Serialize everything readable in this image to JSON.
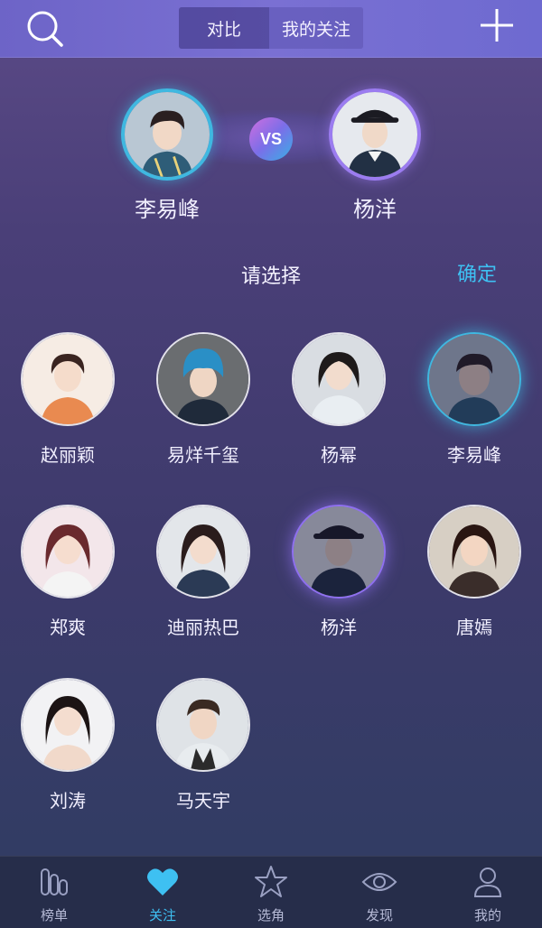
{
  "header": {
    "search_icon": "search-icon",
    "add_icon": "plus-icon",
    "segments": [
      {
        "label": "对比",
        "active": true
      },
      {
        "label": "我的关注",
        "active": false
      }
    ]
  },
  "versus": {
    "left": {
      "name": "李易峰",
      "ring_color": "#3fb8e0"
    },
    "badge": "VS",
    "right": {
      "name": "杨洋",
      "ring_color": "#9b7cf0"
    }
  },
  "chooser": {
    "title": "请选择",
    "confirm": "确定",
    "confirm_color": "#3ec0f2"
  },
  "celebrities": [
    {
      "name": "赵丽颖"
    },
    {
      "name": "易烊千玺"
    },
    {
      "name": "杨幂"
    },
    {
      "name": "李易峰",
      "selected": "left"
    },
    {
      "name": "郑爽"
    },
    {
      "name": "迪丽热巴"
    },
    {
      "name": "杨洋",
      "selected": "right"
    },
    {
      "name": "唐嫣"
    },
    {
      "name": "刘涛"
    },
    {
      "name": "马天宇"
    }
  ],
  "tabbar": {
    "items": [
      {
        "label": "榜单",
        "icon": "chart-bars-icon"
      },
      {
        "label": "关注",
        "icon": "heart-icon",
        "active": true
      },
      {
        "label": "选角",
        "icon": "star-icon"
      },
      {
        "label": "发现",
        "icon": "eye-icon"
      },
      {
        "label": "我的",
        "icon": "user-icon"
      }
    ],
    "active_color": "#3ec0f2"
  }
}
